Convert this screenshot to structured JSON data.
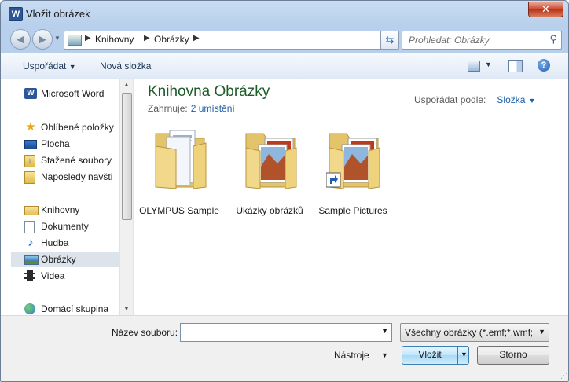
{
  "window": {
    "title": "Vložit obrázek",
    "app_icon_letter": "W",
    "close_symbol": "✕"
  },
  "nav": {
    "breadcrumbs": [
      "Knihovny",
      "Obrázky"
    ],
    "search_placeholder": "Prohledat: Obrázky"
  },
  "toolbar": {
    "organize_label": "Uspořádat",
    "new_folder_label": "Nová složka",
    "help_symbol": "?"
  },
  "sidebar": {
    "items": [
      {
        "label": "Microsoft Word",
        "icon": "word-icon"
      },
      {
        "label": "Oblíbené položky",
        "icon": "star-icon"
      },
      {
        "label": "Plocha",
        "icon": "desktop-icon"
      },
      {
        "label": "Stažené soubory",
        "icon": "downloads-icon"
      },
      {
        "label": "Naposledy navšti",
        "icon": "recent-places-icon"
      },
      {
        "label": "Knihovny",
        "icon": "libraries-icon"
      },
      {
        "label": "Dokumenty",
        "icon": "documents-icon"
      },
      {
        "label": "Hudba",
        "icon": "music-icon"
      },
      {
        "label": "Obrázky",
        "icon": "pictures-icon",
        "selected": true
      },
      {
        "label": "Videa",
        "icon": "videos-icon"
      },
      {
        "label": "Domácí skupina",
        "icon": "homegroup-icon"
      }
    ]
  },
  "content": {
    "library_title": "Knihovna Obrázky",
    "includes_label": "Zahrnuje:",
    "includes_link": "2 umístění",
    "arrange_label": "Uspořádat podle:",
    "arrange_value": "Složka",
    "folders": [
      {
        "name": "OLYMPUS Sample",
        "icon": "folder-documents-icon"
      },
      {
        "name": "Ukázky obrázků",
        "icon": "folder-pictures-icon"
      },
      {
        "name": "Sample Pictures",
        "icon": "folder-pictures-shortcut-icon"
      }
    ]
  },
  "bottom": {
    "filename_label": "Název souboru:",
    "filename_value": "",
    "filter_value": "Všechny obrázky (*.emf;*.wmf;*",
    "tools_label": "Nástroje",
    "insert_label": "Vložit",
    "cancel_label": "Storno"
  }
}
